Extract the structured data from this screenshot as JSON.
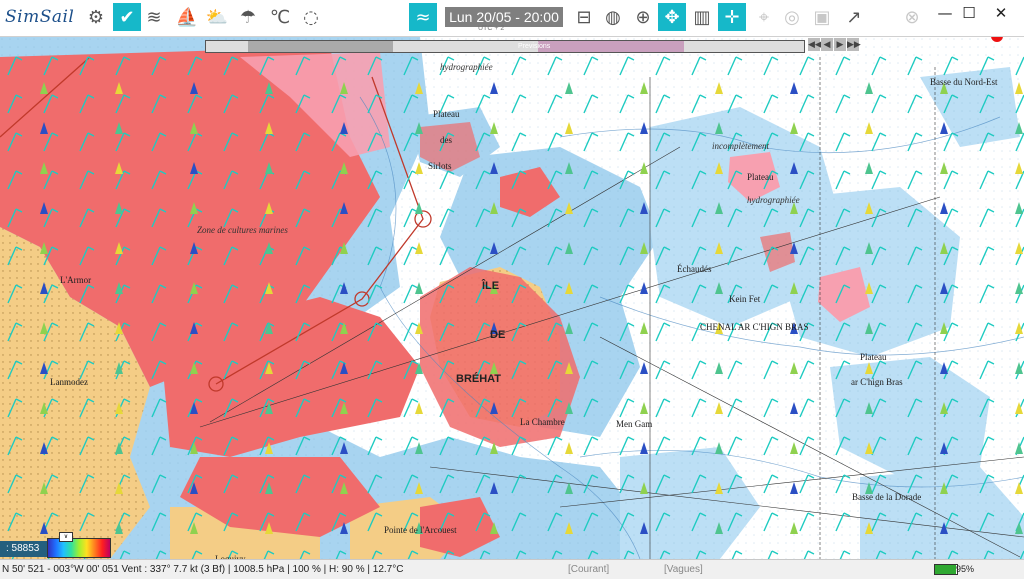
{
  "app": {
    "title": "SimSail"
  },
  "toolbar": {
    "datetime": "Lun 20/05 - 20:00",
    "timezone": "UTC + 2",
    "icons": [
      {
        "name": "settings-icon",
        "glyph": "⚙",
        "active": false
      },
      {
        "name": "check-icon",
        "glyph": "✔",
        "active": true
      },
      {
        "name": "wind-icon",
        "glyph": "≋",
        "active": false
      },
      {
        "name": "sail-icon",
        "glyph": "⛵",
        "active": false
      },
      {
        "name": "weather-icon",
        "glyph": "⛅",
        "active": false
      },
      {
        "name": "rain-icon",
        "glyph": "☂",
        "active": false
      },
      {
        "name": "temperature-icon",
        "glyph": "℃",
        "active": false
      },
      {
        "name": "swell-icon",
        "glyph": "◌",
        "active": false
      },
      {
        "name": "wave-icon",
        "glyph": "≈",
        "active": true
      },
      {
        "name": "layers-icon",
        "glyph": "⊟",
        "active": false
      },
      {
        "name": "globe-icon",
        "glyph": "◍",
        "active": false
      },
      {
        "name": "grid-globe-icon",
        "glyph": "⊕",
        "active": false
      },
      {
        "name": "navigation-icon",
        "glyph": "✥",
        "active": true
      },
      {
        "name": "chart-map-icon",
        "glyph": "▥",
        "active": false
      },
      {
        "name": "crosshair-icon",
        "glyph": "✛",
        "active": true
      },
      {
        "name": "location-pin-icon",
        "glyph": "⌖",
        "active": false,
        "faded": true
      },
      {
        "name": "target-icon",
        "glyph": "◎",
        "active": false,
        "faded": true
      },
      {
        "name": "device-icon",
        "glyph": "▣",
        "active": false,
        "faded": true
      },
      {
        "name": "stats-icon",
        "glyph": "↗",
        "active": false
      },
      {
        "name": "buoy-icon",
        "glyph": "⊗",
        "active": false,
        "faded": true
      }
    ],
    "window": {
      "minimize": "—",
      "maximize": "☐",
      "close": "✕"
    }
  },
  "timeline": {
    "label": "Previsions",
    "progress_fraction": 0.5
  },
  "playback": [
    "◀◀",
    "◀",
    "▶",
    "▶▶"
  ],
  "map": {
    "places": [
      {
        "text": "ÎLE",
        "big": true
      },
      {
        "text": "DE",
        "big": true
      },
      {
        "text": "BRÉHAT",
        "big": true
      },
      {
        "text": "Plateau",
        "italic": false
      },
      {
        "text": "des",
        "italic": false
      },
      {
        "text": "Sirlots",
        "italic": false
      },
      {
        "text": "hydrographiée",
        "italic": true
      },
      {
        "text": "incomplètement",
        "italic": true
      },
      {
        "text": "Plateau",
        "italic": false
      },
      {
        "text": "hydrographiée",
        "italic": true
      },
      {
        "text": "Échaudés",
        "italic": false
      },
      {
        "text": "Plateau",
        "italic": false
      },
      {
        "text": "ar C'hign Bras",
        "italic": false
      },
      {
        "text": "CHENAL AR C'HIGN BRAS",
        "italic": false
      },
      {
        "text": "Lanmodez",
        "italic": false
      },
      {
        "text": "Pointe de l'Arcouest",
        "italic": false
      },
      {
        "text": "Loguivy",
        "italic": false
      },
      {
        "text": "La Chambre",
        "italic": false
      },
      {
        "text": "Basse de la Dorade",
        "italic": false
      },
      {
        "text": "Basse du Nord-Est",
        "italic": false
      },
      {
        "text": "Kein Fet",
        "italic": false
      },
      {
        "text": "Men Gam",
        "italic": false
      },
      {
        "text": "L'Armor",
        "italic": false
      },
      {
        "text": "Zone de cultures marines",
        "italic": true
      }
    ]
  },
  "status": {
    "scale": ": 58853",
    "coords": "N 50' 521 - 003°W 00' 051   Vent : 337° 7.7 kt (3 Bf) | 1008.5 hPa | 100 % | H: 90 % | 12.7°C",
    "courant": "[Courant]",
    "vagues": "[Vagues]",
    "battery": "95%",
    "battery_level": 0.95,
    "palette_toggle": "∨"
  },
  "colors": {
    "land": "#f4cd86",
    "drying": "#f06c6c",
    "shallow": "#a8d4f0",
    "deep": "#ffffff",
    "accent": "#16b8c9",
    "route": "#c0392b"
  }
}
